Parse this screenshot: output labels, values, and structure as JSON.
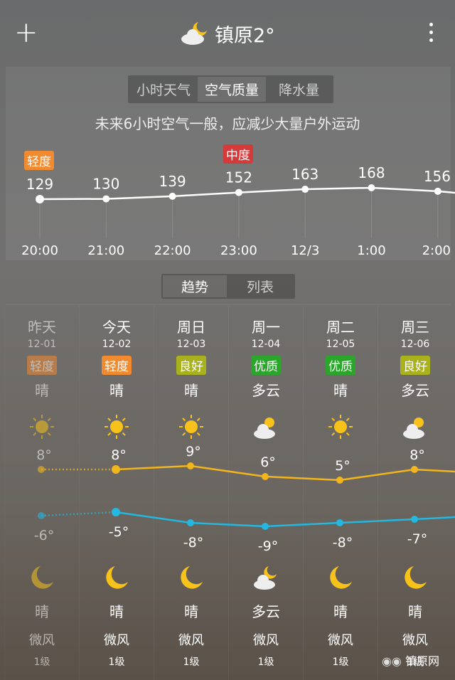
{
  "header": {
    "city_temp": "镇原2°",
    "icon": "cloudy-night-icon"
  },
  "tabs": [
    {
      "label": "小时天气",
      "active": false
    },
    {
      "label": "空气质量",
      "active": true
    },
    {
      "label": "降水量",
      "active": false
    }
  ],
  "aqi": {
    "tip": "未来6小时空气一般，应减少大量户外运动",
    "badges": [
      {
        "label": "轻度",
        "color": "#f28a30",
        "index": 0
      },
      {
        "label": "中度",
        "color": "#d43a3a",
        "index": 3
      }
    ],
    "chart_data": {
      "type": "line",
      "x": [
        "20:00",
        "21:00",
        "22:00",
        "23:00",
        "12/3",
        "1:00",
        "2:00"
      ],
      "values": [
        129,
        130,
        139,
        152,
        163,
        168,
        156
      ]
    }
  },
  "view_tabs": [
    {
      "label": "趋势",
      "active": true
    },
    {
      "label": "列表",
      "active": false
    }
  ],
  "days": [
    {
      "day": "昨天",
      "date": "12-01",
      "aq": "轻度",
      "aq_color": "#f28a30",
      "day_wx": "晴",
      "day_icon": "sun-icon",
      "high": 8,
      "high_label": "8°",
      "low": -6,
      "low_label": "-6°",
      "night_icon": "moon-icon",
      "night_wx": "晴",
      "wind": "微风",
      "wind_level": "1级",
      "past": true
    },
    {
      "day": "今天",
      "date": "12-02",
      "aq": "轻度",
      "aq_color": "#f28a30",
      "day_wx": "晴",
      "day_icon": "sun-icon",
      "high": 8,
      "high_label": "8°",
      "low": -5,
      "low_label": "-5°",
      "night_icon": "moon-icon",
      "night_wx": "晴",
      "wind": "微风",
      "wind_level": "1级"
    },
    {
      "day": "周日",
      "date": "12-03",
      "aq": "良好",
      "aq_color": "#a9b21c",
      "day_wx": "晴",
      "day_icon": "sun-icon",
      "high": 9,
      "high_label": "9°",
      "low": -8,
      "low_label": "-8°",
      "night_icon": "moon-icon",
      "night_wx": "晴",
      "wind": "微风",
      "wind_level": "1级"
    },
    {
      "day": "周一",
      "date": "12-04",
      "aq": "优质",
      "aq_color": "#2aa62a",
      "day_wx": "多云",
      "day_icon": "partly-cloudy-icon",
      "high": 6,
      "high_label": "6°",
      "low": -9,
      "low_label": "-9°",
      "night_icon": "cloudy-night-icon",
      "night_wx": "多云",
      "wind": "微风",
      "wind_level": "1级"
    },
    {
      "day": "周二",
      "date": "12-05",
      "aq": "优质",
      "aq_color": "#2aa62a",
      "day_wx": "晴",
      "day_icon": "sun-icon",
      "high": 5,
      "high_label": "5°",
      "low": -8,
      "low_label": "-8°",
      "night_icon": "moon-icon",
      "night_wx": "晴",
      "wind": "微风",
      "wind_level": "1级"
    },
    {
      "day": "周三",
      "date": "12-06",
      "aq": "良好",
      "aq_color": "#a9b21c",
      "day_wx": "多云",
      "day_icon": "partly-cloudy-icon",
      "high": 8,
      "high_label": "8°",
      "low": -7,
      "low_label": "-7°",
      "night_icon": "moon-icon",
      "night_wx": "晴",
      "wind": "微风",
      "wind_level": "1级"
    }
  ],
  "colors": {
    "high_line": "#f2b51c",
    "low_line": "#22b8e0",
    "sun": "#f7c21a"
  },
  "watermark": "镇原网"
}
